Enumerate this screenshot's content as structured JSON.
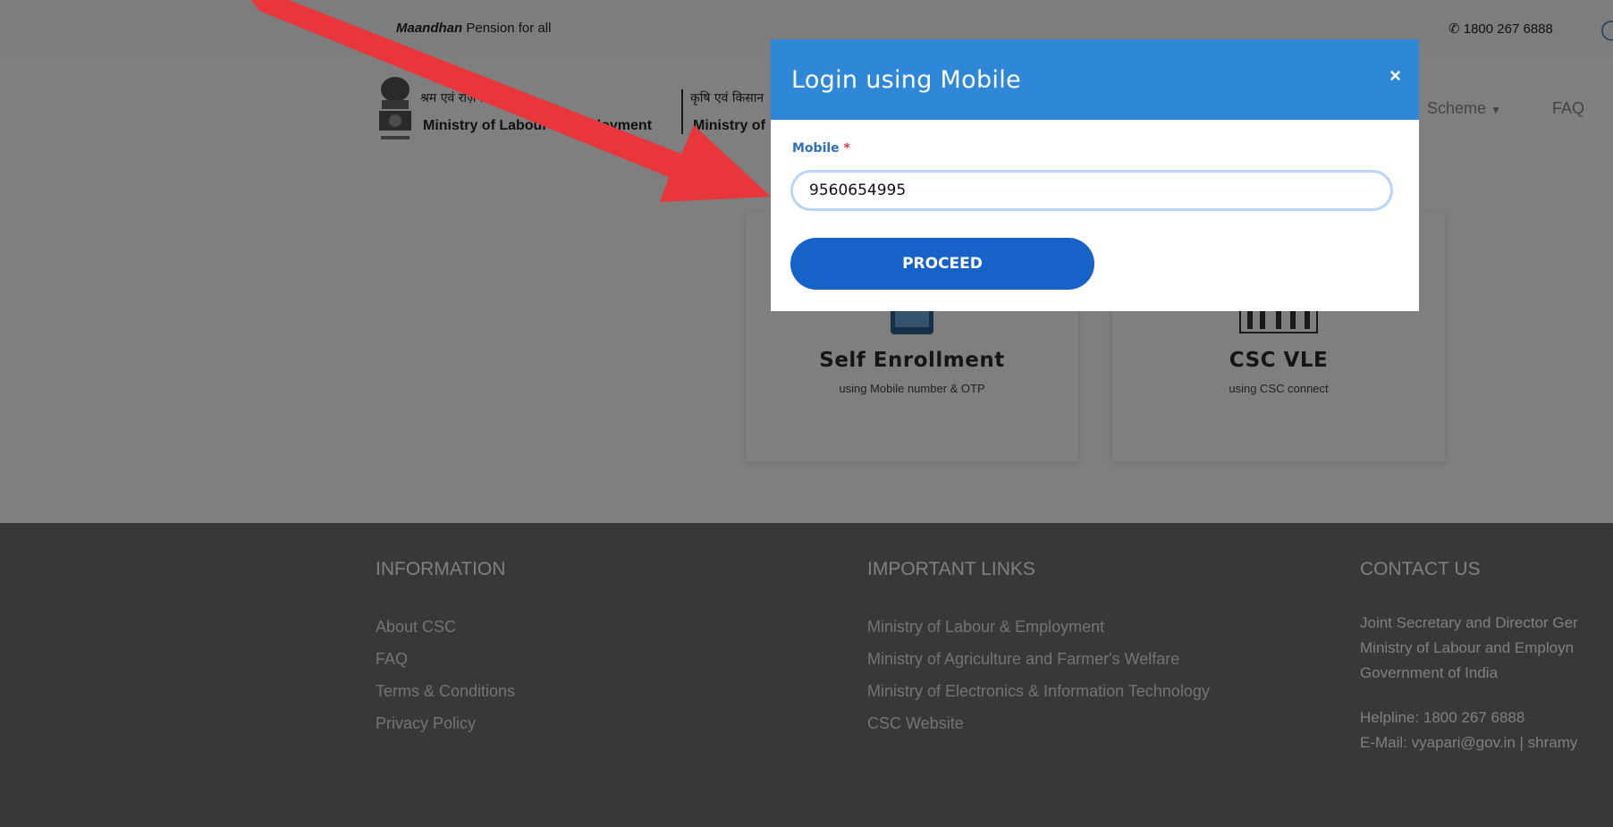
{
  "topbar": {
    "brand": "Maandhan",
    "tagline_rest": " Pension for all",
    "helpline": "1800 267 6888"
  },
  "header": {
    "ministry1_hindi": "श्रम एवं रोज़गार मंत्रालय",
    "ministry1_eng": "Ministry of Labour & Employment",
    "ministry2_hindi": "कृषि एवं किसान",
    "ministry2_eng": "Ministry of",
    "nav_scheme": "Scheme",
    "nav_faq": "FAQ"
  },
  "cards": [
    {
      "title": "Self Enrollment",
      "subtitle": "using Mobile number & OTP"
    },
    {
      "title": "CSC VLE",
      "subtitle": "using CSC connect"
    }
  ],
  "footer": {
    "information": {
      "heading": "INFORMATION",
      "links": [
        "About CSC",
        "FAQ",
        "Terms & Conditions",
        "Privacy Policy"
      ]
    },
    "important_links": {
      "heading": "IMPORTANT LINKS",
      "links": [
        "Ministry of Labour & Employment",
        "Ministry of Agriculture and Farmer's Welfare",
        "Ministry of Electronics & Information Technology",
        "CSC Website"
      ]
    },
    "contact": {
      "heading": "CONTACT US",
      "lines": [
        "Joint Secretary and Director Ger",
        "Ministry of Labour and Employn",
        "Government of India"
      ],
      "helpline": "Helpline: 1800 267 6888",
      "email": "E-Mail: vyapari@gov.in | shramy"
    }
  },
  "modal": {
    "title": "Login using Mobile",
    "close": "×",
    "field_label": "Mobile",
    "required_mark": "*",
    "mobile_value": "9560654995",
    "proceed_label": "PROCEED"
  },
  "colors": {
    "modal_header": "#2f87d8",
    "proceed_button": "#1762c9",
    "arrow": "#e8363b",
    "footer_bg": "#6f7174"
  }
}
